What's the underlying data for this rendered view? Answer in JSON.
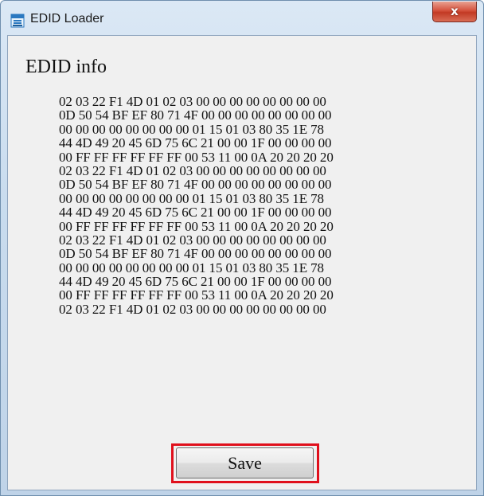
{
  "window": {
    "title": "EDID Loader",
    "close_label": "x"
  },
  "main": {
    "section_label": "EDID info",
    "hex_lines": [
      "02 03 22 F1 4D 01 02 03 00 00 00 00 00 00 00 00",
      "0D 50 54 BF EF 80 71 4F 00 00 00 00 00 00 00 00",
      "00 00 00 00 00 00 00 00 01 15 01 03 80 35 1E 78",
      "44 4D 49 20 45 6D 75 6C 21 00 00 1F 00 00 00 00",
      "00 FF FF FF FF FF FF 00 53 11 00 0A 20 20 20 20",
      "02 03 22 F1 4D 01 02 03 00 00 00 00 00 00 00 00",
      "0D 50 54 BF EF 80 71 4F 00 00 00 00 00 00 00 00",
      "00 00 00 00 00 00 00 00 01 15 01 03 80 35 1E 78",
      "44 4D 49 20 45 6D 75 6C 21 00 00 1F 00 00 00 00",
      "00 FF FF FF FF FF FF 00 53 11 00 0A 20 20 20 20",
      "02 03 22 F1 4D 01 02 03 00 00 00 00 00 00 00 00",
      "0D 50 54 BF EF 80 71 4F 00 00 00 00 00 00 00 00",
      "00 00 00 00 00 00 00 00 01 15 01 03 80 35 1E 78",
      "44 4D 49 20 45 6D 75 6C 21 00 00 1F 00 00 00 00",
      "00 FF FF FF FF FF FF 00 53 11 00 0A 20 20 20 20",
      "02 03 22 F1 4D 01 02 03 00 00 00 00 00 00 00 00"
    ]
  },
  "footer": {
    "save_label": "Save"
  },
  "colors": {
    "highlight": "#e0101c",
    "client_background": "#f0f0f0",
    "titlebar": "#c9dcee",
    "close_button": "#c23a24"
  },
  "icons": {
    "app": "edid-loader-app-icon",
    "close": "close-icon"
  }
}
